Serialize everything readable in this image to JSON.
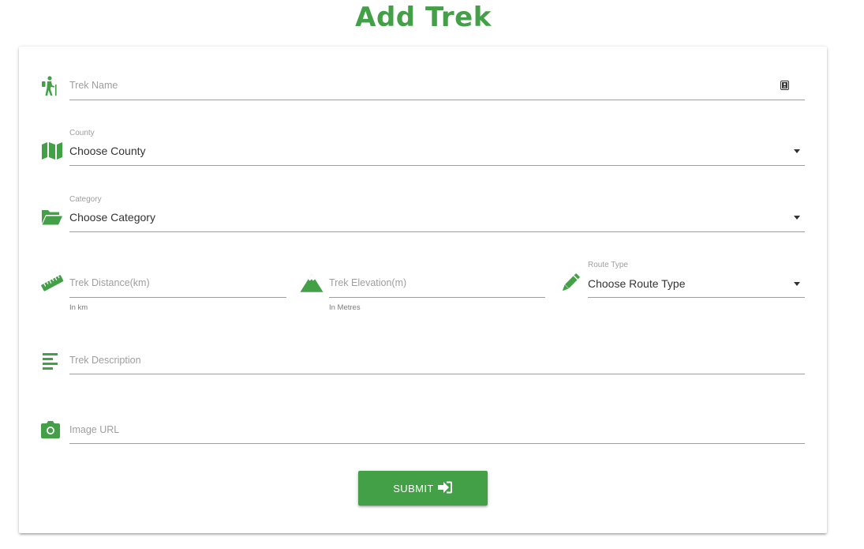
{
  "page": {
    "title": "Add Trek"
  },
  "fields": {
    "trek_name": {
      "placeholder": "Trek Name"
    },
    "county": {
      "label": "County",
      "value": "Choose County"
    },
    "category": {
      "label": "Category",
      "value": "Choose Category"
    },
    "distance": {
      "placeholder": "Trek Distance(km)",
      "helper": "In km"
    },
    "elevation": {
      "placeholder": "Trek Elevation(m)",
      "helper": "In Metres"
    },
    "route_type": {
      "label": "Route Type",
      "value": "Choose Route Type"
    },
    "description": {
      "placeholder": "Trek Description"
    },
    "image_url": {
      "placeholder": "Image URL"
    }
  },
  "submit": {
    "label": "SUBMIT"
  },
  "theme": {
    "accent": "#43a047",
    "line": "#9e9e9e"
  },
  "icons": [
    "hiking-icon",
    "map-icon",
    "folder-open-icon",
    "ruler-icon",
    "mountain-icon",
    "pencil-icon",
    "align-left-icon",
    "camera-icon",
    "contact-card-icon",
    "sign-in-icon",
    "caret-down-icon"
  ]
}
